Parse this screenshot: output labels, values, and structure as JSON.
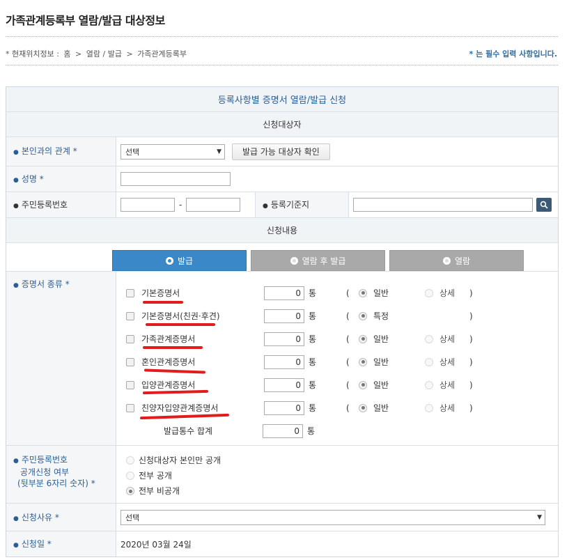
{
  "title": "가족관계등록부 열람/발급 대상정보",
  "breadcrumb": {
    "prefix": "* 현재위치정보 : ",
    "items": [
      "홈",
      "열람 / 발급",
      "가족관계등록부"
    ],
    "separator": ">"
  },
  "required_note": "* 는 필수 입력 사항입니다.",
  "form": {
    "header": "등록사항별 증명서 열람/발급 신청",
    "section_target": "신청대상자",
    "relation": {
      "label": "본인과의 관계 *",
      "select_value": "선택",
      "check_button": "발급 가능 대상자 확인"
    },
    "name": {
      "label": "성명 *",
      "value": ""
    },
    "rrn": {
      "label": "주민등록번호",
      "front": "",
      "dash": "-",
      "back": ""
    },
    "reg_base": {
      "label": "등록기준지",
      "value": ""
    },
    "section_content": "신청내용",
    "tabs": [
      {
        "label": "발급",
        "active": true
      },
      {
        "label": "열람 후 발급",
        "active": false
      },
      {
        "label": "열람",
        "active": false
      }
    ],
    "cert_type_label": "증명서 종류 *",
    "certs": [
      {
        "name": "기본증명서",
        "count": "0",
        "unit": "통",
        "open": "(",
        "opt1": "일반",
        "opt2": "상세",
        "close": ")"
      },
      {
        "name": "기본증명서(친권·후견)",
        "count": "0",
        "unit": "통",
        "open": "(",
        "opt1": "특정",
        "opt2": "",
        "close": ")"
      },
      {
        "name": "가족관계증명서",
        "count": "0",
        "unit": "통",
        "open": "(",
        "opt1": "일반",
        "opt2": "상세",
        "close": ")"
      },
      {
        "name": "혼인관계증명서",
        "count": "0",
        "unit": "통",
        "open": "(",
        "opt1": "일반",
        "opt2": "상세",
        "close": ")"
      },
      {
        "name": "입양관계증명서",
        "count": "0",
        "unit": "통",
        "open": "(",
        "opt1": "일반",
        "opt2": "상세",
        "close": ")"
      },
      {
        "name": "친양자입양관계증명서",
        "count": "0",
        "unit": "통",
        "open": "(",
        "opt1": "일반",
        "opt2": "상세",
        "close": ")"
      }
    ],
    "total": {
      "label": "발급통수 합계",
      "count": "0",
      "unit": "통"
    },
    "rrn_disclosure": {
      "label_lines": [
        "주민등록번호",
        "공개신청 여부",
        "(뒷부분 6자리 숫자) *"
      ],
      "options": [
        "신청대상자 본인만 공개",
        "전부 공개",
        "전부 비공개"
      ],
      "selected_index": 2
    },
    "reason": {
      "label": "신청사유 *",
      "select_value": "선택"
    },
    "date": {
      "label": "신청일 *",
      "value": "2020년 03월 24일"
    }
  },
  "colors": {
    "accent": "#3a88c8",
    "label_text": "#2a5e94",
    "annotation_red": "#e21c1c"
  }
}
